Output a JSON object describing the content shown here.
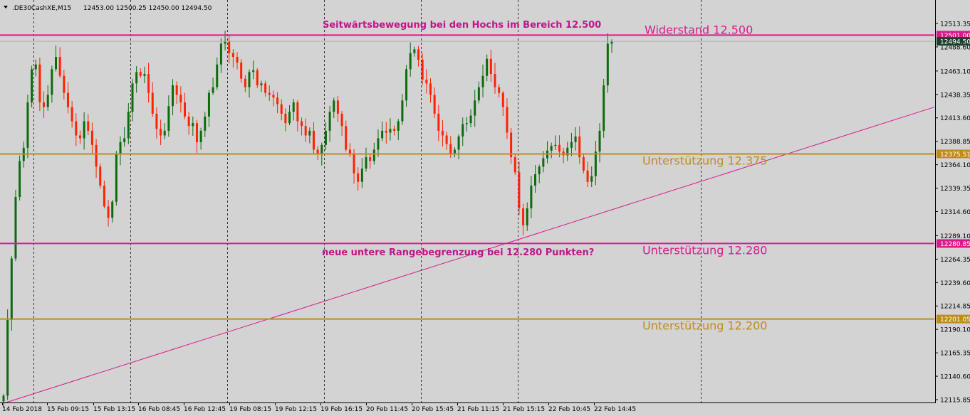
{
  "header": {
    "symbol": ".DE30CashXE,M15",
    "ohlc": "12453.00 12500.25 12450.00 12494.50"
  },
  "colors": {
    "background": "#d3d3d3",
    "bull": "#0c6b0c",
    "bear": "#ff2200",
    "resistance": "#d81b8c",
    "support": "#c08b1a",
    "trendline": "#d81b8c"
  },
  "chart_data": {
    "type": "candlestick",
    "timeframe": "M15",
    "ylim": [
      12115.85,
      12525.5
    ],
    "y_ticks": [
      "12513.35",
      "12488.60",
      "12463.10",
      "12438.35",
      "12413.60",
      "12388.85",
      "12364.10",
      "12339.35",
      "12314.60",
      "12289.10",
      "12264.35",
      "12239.60",
      "12214.85",
      "12190.10",
      "12165.35",
      "12140.60",
      "12115.85"
    ],
    "x_ticks": [
      "14 Feb 2018",
      "15 Feb 09:15",
      "15 Feb 13:15",
      "16 Feb 08:45",
      "16 Feb 12:45",
      "19 Feb 08:15",
      "19 Feb 12:15",
      "19 Feb 16:15",
      "20 Feb 11:45",
      "20 Feb 15:45",
      "21 Feb 11:15",
      "21 Feb 15:15",
      "22 Feb 10:45",
      "22 Feb 14:45"
    ],
    "grid": "vertical dotted session separators",
    "horizontal_lines": [
      {
        "label": "Widerstand 12.500",
        "price": 12501.0,
        "badge": "12501.00",
        "color": "#d81b8c"
      },
      {
        "label": "Unterstützung 12.375",
        "price": 12375.51,
        "badge": "12375.51",
        "color": "#c08b1a"
      },
      {
        "label": "Unterstützung 12.280",
        "price": 12280.85,
        "badge": "12280.85",
        "color": "#d81b8c"
      },
      {
        "label": "Unterstützung 12.200",
        "price": 12201.05,
        "badge": "12201.05",
        "color": "#c08b1a"
      }
    ],
    "current_price": {
      "value": 12494.5,
      "badge": "12494.50"
    },
    "trendline": {
      "from_price": 12112.0,
      "to_price": 12425.0,
      "color": "#d81b8c"
    },
    "annotations": [
      "Seitwärtsbewegung bei den Hochs im Bereich 12.500",
      "neue untere Rangebegrenzung bei 12.280 Punkten?"
    ],
    "path_points": [
      12120,
      12200,
      12265,
      12330,
      12368,
      12382,
      12430,
      12465,
      12470,
      12430,
      12425,
      12438,
      12465,
      12478,
      12458,
      12440,
      12425,
      12410,
      12395,
      12392,
      12410,
      12400,
      12385,
      12362,
      12342,
      12320,
      12308,
      12325,
      12375,
      12388,
      12392,
      12420,
      12450,
      12462,
      12458,
      12460,
      12440,
      12418,
      12402,
      12395,
      12400,
      12426,
      12448,
      12438,
      12430,
      12415,
      12405,
      12408,
      12388,
      12400,
      12415,
      12440,
      12446,
      12470,
      12492,
      12495,
      12482,
      12478,
      12472,
      12455,
      12446,
      12462,
      12464,
      12448,
      12450,
      12440,
      12438,
      12435,
      12428,
      12418,
      12408,
      12420,
      12430,
      12410,
      12405,
      12395,
      12400,
      12380,
      12375,
      12385,
      12400,
      12420,
      12432,
      12418,
      12405,
      12380,
      12375,
      12355,
      12346,
      12360,
      12372,
      12368,
      12380,
      12392,
      12400,
      12398,
      12402,
      12400,
      12410,
      12432,
      12465,
      12482,
      12486,
      12475,
      12454,
      12450,
      12438,
      12418,
      12400,
      12395,
      12386,
      12376,
      12380,
      12394,
      12407,
      12408,
      12416,
      12432,
      12446,
      12458,
      12476,
      12460,
      12446,
      12440,
      12425,
      12398,
      12372,
      12356,
      12318,
      12300,
      12318,
      12342,
      12354,
      12362,
      12371,
      12379,
      12384,
      12385,
      12378,
      12374,
      12382,
      12388,
      12394,
      12372,
      12358,
      12346,
      12352,
      12378,
      12400,
      12448,
      12492,
      12494.5
    ]
  }
}
